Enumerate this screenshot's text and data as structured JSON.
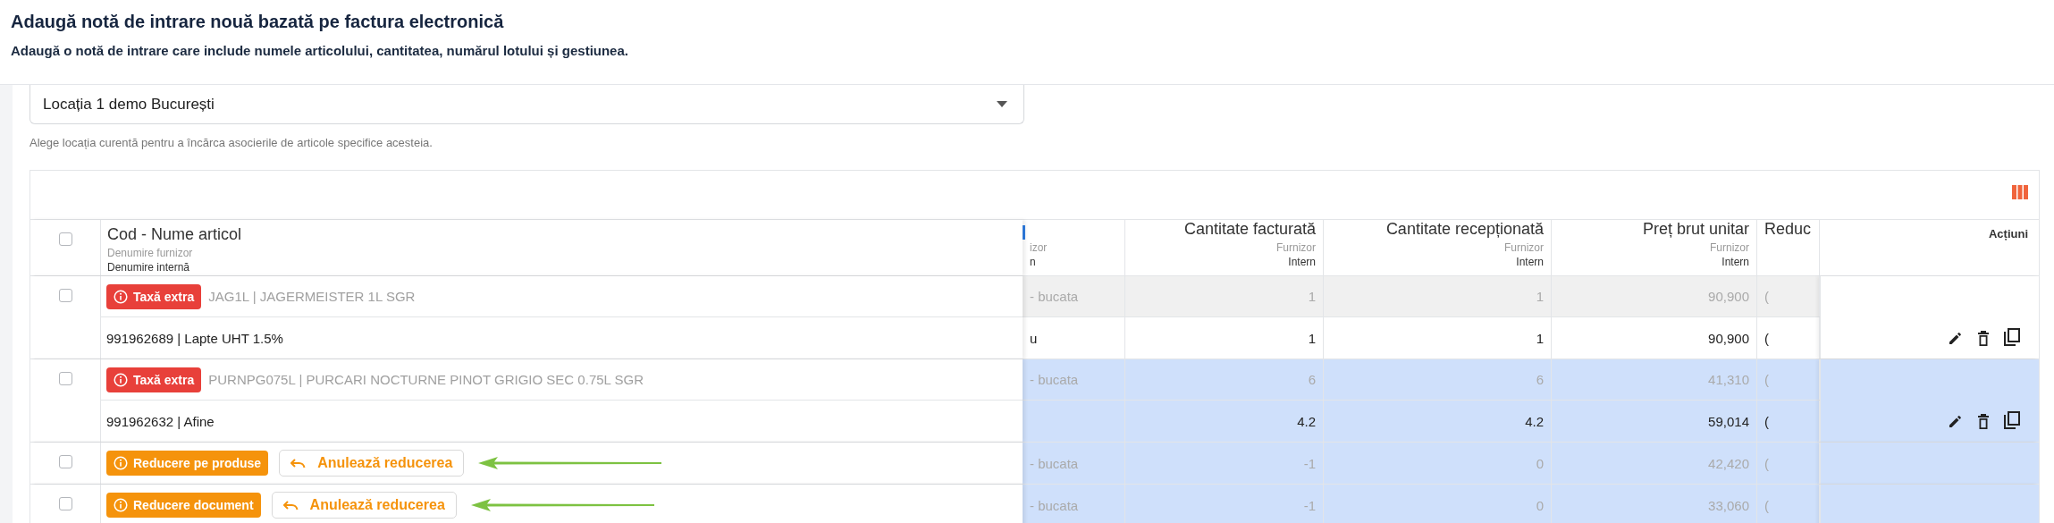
{
  "header": {
    "title": "Adaugă notă de intrare nouă bazată pe factura electronică",
    "subtitle": "Adaugă o notă de intrare care include numele articolului, cantitatea, numărul lotului și gestiunea."
  },
  "select_all_checked": false,
  "location": {
    "value": "Locația 1 demo București",
    "hint": "Alege locația curentă pentru a încărca asocierile de articole specifice acesteia."
  },
  "table": {
    "columns": [
      {
        "label": "Cod - Nume articol",
        "supplier": "Denumire furnizor",
        "internal": "Denumire internă"
      },
      {
        "supplier": "izor",
        "internal": "n"
      },
      {
        "label": "Cantitate facturată",
        "supplier": "Furnizor",
        "internal": "Intern"
      },
      {
        "label": "Cantitate recepționată",
        "supplier": "Furnizor",
        "internal": "Intern"
      },
      {
        "label": "Preț brut unitar",
        "supplier": "Furnizor",
        "internal": "Intern"
      },
      {
        "label": "Reduc"
      },
      {
        "label": "Acțiuni"
      }
    ],
    "rows": [
      {
        "kind": "item",
        "selected": false,
        "checked": false,
        "badge": {
          "kind": "tax",
          "label": "Taxă extra"
        },
        "supplier": {
          "name": "JAG1L | JAGERMEISTER 1L SGR",
          "cells": [
            "- bucata",
            "1",
            "1",
            "90,900",
            "("
          ]
        },
        "internal": {
          "name": "991962689 | Lapte UHT 1.5%",
          "cells": [
            "u",
            "1",
            "1",
            "90,900",
            "("
          ]
        }
      },
      {
        "kind": "item",
        "selected": true,
        "checked": false,
        "badge": {
          "kind": "tax",
          "label": "Taxă extra"
        },
        "supplier": {
          "name": "PURNPG075L | PURCARI NOCTURNE PINOT GRIGIO SEC 0.75L SGR",
          "cells": [
            "- bucata",
            "6",
            "6",
            "41,310",
            "("
          ]
        },
        "internal": {
          "name": "991962632 | Afine",
          "cells": [
            "",
            "4.2",
            "4.2",
            "59,014",
            "("
          ]
        }
      },
      {
        "kind": "discount",
        "selected": true,
        "checked": false,
        "badge": {
          "kind": "discount",
          "label": "Reducere pe produse"
        },
        "undo": "Anulează reducerea",
        "pointer": true,
        "supplier": {
          "cells": [
            "- bucata",
            "-1",
            "0",
            "42,420",
            "("
          ]
        }
      },
      {
        "kind": "discount",
        "selected": true,
        "checked": false,
        "badge": {
          "kind": "discount",
          "label": "Reducere document"
        },
        "undo": "Anulează reducerea",
        "pointer": true,
        "supplier": {
          "cells": [
            "- bucata",
            "-1",
            "0",
            "33,060",
            "("
          ]
        }
      }
    ]
  }
}
